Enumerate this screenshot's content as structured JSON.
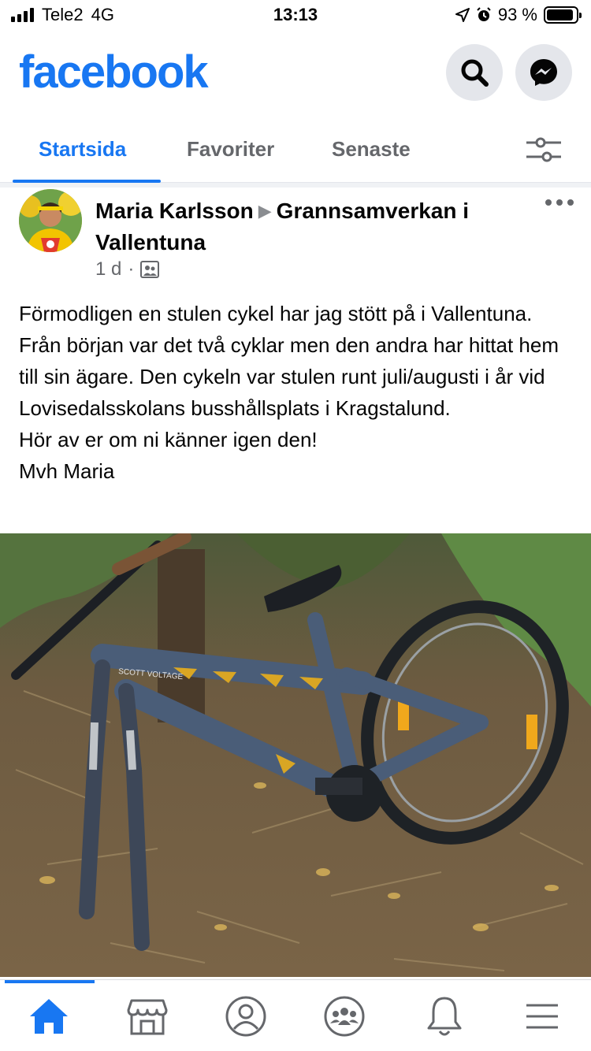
{
  "status_bar": {
    "carrier": "Tele2",
    "network": "4G",
    "time": "13:13",
    "battery_label": "93 %",
    "battery_level": 0.93
  },
  "header": {
    "logo": "facebook",
    "brand_color": "#1877f2",
    "search_icon": "search-icon",
    "messenger_icon": "messenger-icon"
  },
  "tabs": {
    "items": [
      {
        "label": "Startsida",
        "active": true
      },
      {
        "label": "Favoriter",
        "active": false
      },
      {
        "label": "Senaste",
        "active": false
      }
    ],
    "filter_icon": "filter-sliders-icon"
  },
  "post": {
    "author": "Maria Karlsson",
    "group": "Grannsamverkan i Vallentuna",
    "time": "1 d",
    "separator": "·",
    "audience_icon": "group-audience-icon",
    "text_lines": [
      "Förmodligen en stulen cykel har jag stött på i Vallentuna. Från början var det två cyklar men den andra har hittat hem till sin ägare. Den cykeln var stulen runt juli/augusti i år vid Lovisedalsskolans busshållsplats i Kragstalund.",
      "Hör av er om ni känner igen den!",
      "Mvh Maria"
    ],
    "photo_text": "SCOTT VOLTAGE"
  },
  "bottom_nav": {
    "items": [
      "home-icon",
      "marketplace-icon",
      "profile-icon",
      "groups-icon",
      "notifications-icon",
      "menu-icon"
    ]
  }
}
